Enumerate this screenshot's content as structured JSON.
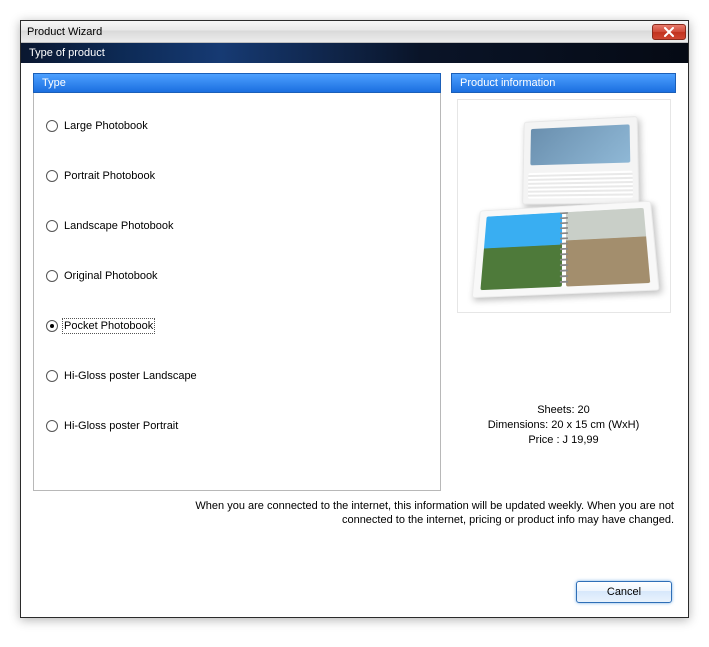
{
  "window": {
    "title": "Product Wizard",
    "subtitle": "Type of product"
  },
  "panes": {
    "left_title": "Type",
    "right_title": "Product information"
  },
  "options": [
    {
      "label": "Large Photobook",
      "selected": false,
      "name": "option-large-photobook"
    },
    {
      "label": "Portrait Photobook",
      "selected": false,
      "name": "option-portrait-photobook"
    },
    {
      "label": "Landscape Photobook",
      "selected": false,
      "name": "option-landscape-photobook"
    },
    {
      "label": "Original Photobook",
      "selected": false,
      "name": "option-original-photobook"
    },
    {
      "label": "Pocket Photobook",
      "selected": true,
      "name": "option-pocket-photobook"
    },
    {
      "label": "Hi-Gloss poster Landscape",
      "selected": false,
      "name": "option-higloss-landscape"
    },
    {
      "label": "Hi-Gloss poster Portrait",
      "selected": false,
      "name": "option-higloss-portrait"
    }
  ],
  "info": {
    "sheets": "Sheets: 20",
    "dimensions": "Dimensions: 20 x 15 cm (WxH)",
    "price": "Price : J 19,99"
  },
  "disclaimer": {
    "line1": "When you are connected to the internet, this information will be updated weekly. When you are not",
    "line2": "connected to the internet, pricing or product info may have changed."
  },
  "buttons": {
    "cancel": "Cancel"
  }
}
